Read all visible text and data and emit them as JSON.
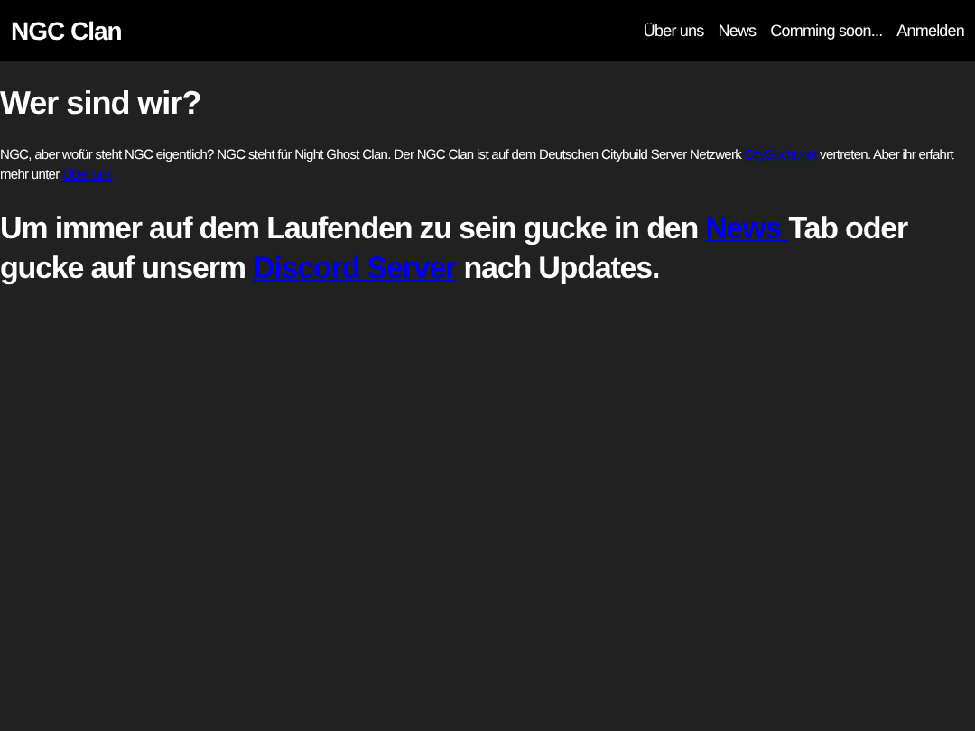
{
  "navbar": {
    "brand": "NGC Clan",
    "links": [
      {
        "label": "Über uns"
      },
      {
        "label": "News"
      },
      {
        "label": "Comming soon..."
      },
      {
        "label": "Anmelden"
      }
    ]
  },
  "section": {
    "heading": "Wer sind wir?",
    "intro": [
      {
        "kind": "text",
        "text": "NGC, aber wofür steht NGC eigentlich? NGC steht für Night Ghost Clan. Der NGC Clan ist auf dem Deutschen Citybuild Server Netzwerk "
      },
      {
        "kind": "link",
        "text": "CitySucht.net"
      },
      {
        "kind": "text",
        "text": " vertreten. Aber ihr erfahrt mehr unter "
      },
      {
        "kind": "link",
        "text": "Über uns"
      }
    ],
    "callout": [
      {
        "kind": "text",
        "text": "Um immer auf dem Laufenden zu sein gucke in den "
      },
      {
        "kind": "link",
        "text": "News "
      },
      {
        "kind": "text",
        "text": "Tab oder gucke auf unserm "
      },
      {
        "kind": "link",
        "text": "Discord Server"
      },
      {
        "kind": "text",
        "text": " nach Updates."
      }
    ]
  }
}
